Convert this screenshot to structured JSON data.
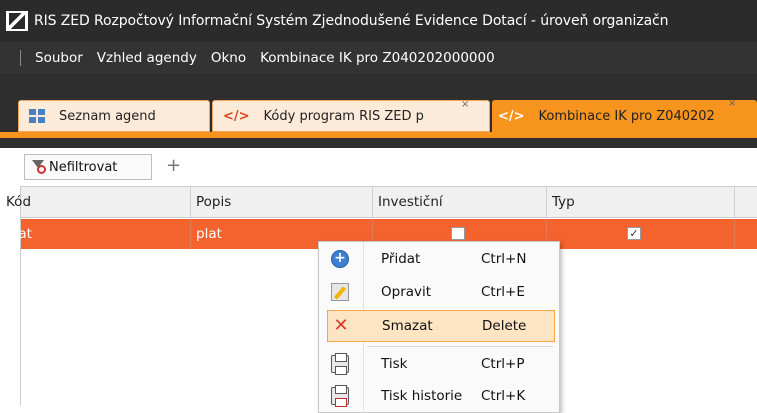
{
  "window": {
    "title": "RIS ZED Rozpočtový Informační Systém Zjednodušené Evidence Dotací - úroveň organizačn"
  },
  "menu": {
    "items": [
      "Soubor",
      "Vzhled agendy",
      "Okno",
      "Kombinace IK pro Z040202000000"
    ]
  },
  "tabs": [
    {
      "label": "Seznam agend",
      "icon": "grid-icon"
    },
    {
      "label": "Kódy program RIS ZED p",
      "icon": "code-icon"
    },
    {
      "label": "Kombinace IK pro Z040202",
      "icon": "code-icon",
      "active": true
    }
  ],
  "toolbar": {
    "filter_label": "Nefiltrovat",
    "add_label": "+"
  },
  "table": {
    "columns": [
      "Kód",
      "Popis",
      "Investiční",
      "Typ"
    ],
    "rows": [
      {
        "kod": "plat",
        "popis": "plat",
        "investicni": false,
        "typ": true
      }
    ]
  },
  "context_menu": {
    "items": [
      {
        "label": "Přidat",
        "shortcut": "Ctrl+N",
        "icon": "add-icon"
      },
      {
        "label": "Opravit",
        "shortcut": "Ctrl+E",
        "icon": "edit-icon"
      },
      {
        "label": "Smazat",
        "shortcut": "Delete",
        "icon": "delete-icon",
        "highlighted": true
      },
      {
        "label": "Tisk",
        "shortcut": "Ctrl+P",
        "icon": "print-icon"
      },
      {
        "label": "Tisk historie",
        "shortcut": "Ctrl+K",
        "icon": "print-history-icon"
      }
    ]
  },
  "colors": {
    "accent": "#f7941d",
    "selected_row": "#f4622d",
    "titlebar": "#2b2b2b"
  }
}
